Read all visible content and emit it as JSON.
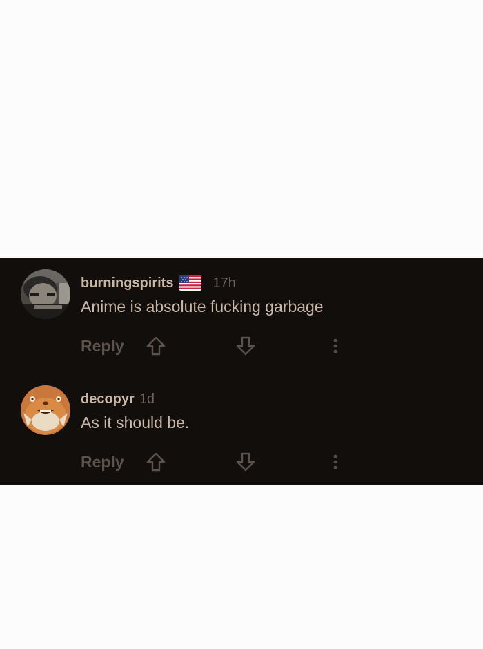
{
  "comments": [
    {
      "username": "burningspirits",
      "flag_icon": "us-flag-icon",
      "time": "17h",
      "text": "Anime is absolute fucking garbage",
      "reply_label": "Reply"
    },
    {
      "username": "decopyr",
      "time": "1d",
      "text": "As it should be.",
      "reply_label": "Reply"
    }
  ],
  "icons": {
    "upvote": "upvote-arrow-icon",
    "downvote": "downvote-arrow-icon",
    "more": "more-vertical-icon"
  },
  "colors": {
    "page_background": "#fcfcfc",
    "panel_background": "#120e0c",
    "username": "#c9b7a6",
    "text": "#c9b8a8",
    "muted": "#6e6259",
    "action": "#5b524b"
  }
}
